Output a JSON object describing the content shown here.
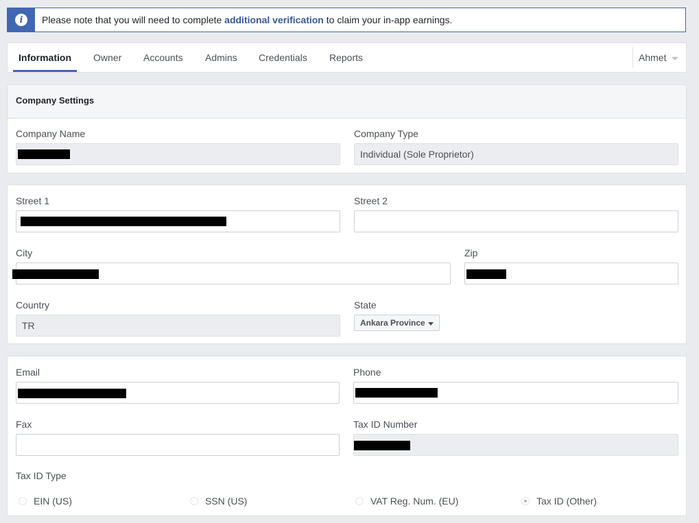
{
  "notice": {
    "text_before": "Please note that you will need to complete ",
    "link_text": "additional verification",
    "text_after": " to claim your in-app earnings."
  },
  "tabs": [
    {
      "label": "Information",
      "active": true
    },
    {
      "label": "Owner"
    },
    {
      "label": "Accounts"
    },
    {
      "label": "Admins"
    },
    {
      "label": "Credentials"
    },
    {
      "label": "Reports"
    }
  ],
  "user": {
    "name": "Ahmet"
  },
  "company": {
    "header": "Company Settings",
    "name_label": "Company Name",
    "name_value": "",
    "type_label": "Company Type",
    "type_value": "Individual (Sole Proprietor)"
  },
  "address": {
    "street1_label": "Street 1",
    "street1_value": "",
    "street2_label": "Street 2",
    "street2_value": "",
    "city_label": "City",
    "city_value": "",
    "zip_label": "Zip",
    "zip_value": "",
    "country_label": "Country",
    "country_value": "TR",
    "state_label": "State",
    "state_value": "Ankara Province"
  },
  "contact": {
    "email_label": "Email",
    "email_value": "",
    "phone_label": "Phone",
    "phone_value": "",
    "fax_label": "Fax",
    "fax_value": "",
    "taxid_label": "Tax ID Number",
    "taxid_value": "",
    "taxid_type_label": "Tax ID Type",
    "taxid_types": [
      {
        "label": "EIN (US)",
        "selected": false
      },
      {
        "label": "SSN (US)",
        "selected": false
      },
      {
        "label": "VAT Reg. Num. (EU)",
        "selected": false
      },
      {
        "label": "Tax ID (Other)",
        "selected": true
      }
    ]
  },
  "colors": {
    "accent": "#4267b2",
    "link": "#365899",
    "page_bg": "#e9ebee"
  },
  "icons": {
    "notice": "info-icon",
    "user_menu": "chevron-down-icon",
    "state_select": "chevron-down-icon"
  }
}
